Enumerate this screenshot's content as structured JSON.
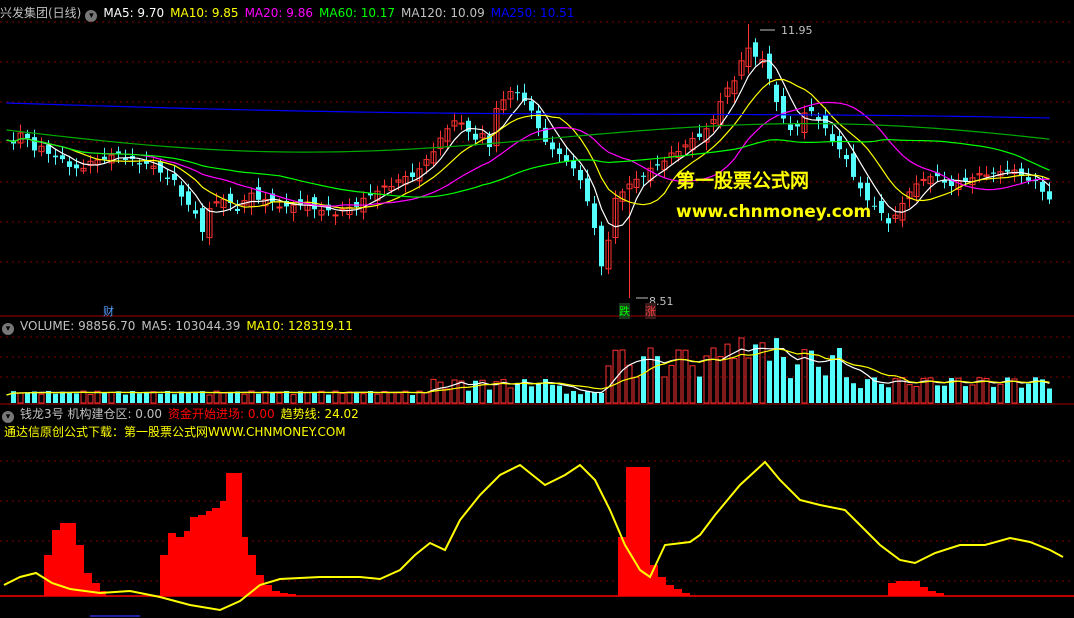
{
  "price_pane": {
    "stock": "兴发集团(日线)",
    "ma": [
      {
        "label": "MA5: 9.70",
        "color": "#ffffff"
      },
      {
        "label": "MA10: 9.85",
        "color": "#ffff00"
      },
      {
        "label": "MA20: 9.86",
        "color": "#ff00ff"
      },
      {
        "label": "MA60: 10.17",
        "color": "#00ff00"
      },
      {
        "label": "MA120: 10.09",
        "color": "#c0c0c0"
      },
      {
        "label": "MA250: 10.51",
        "color": "#0000ff"
      }
    ],
    "high_label": "11.95",
    "low_label": "8.51",
    "marker_cai": "财",
    "marker_die": "跌",
    "marker_zhang": "涨"
  },
  "volume_pane": {
    "labels": [
      {
        "label": "VOLUME: 98856.70",
        "color": "#c0c0c0"
      },
      {
        "label": "MA5: 103044.39",
        "color": "#c0c0c0"
      },
      {
        "label": "MA10: 128319.11",
        "color": "#ffff00"
      }
    ]
  },
  "indicator_pane": {
    "labels": [
      {
        "label": "钱龙3号  机构建仓区: 0.00",
        "color": "#c0c0c0"
      },
      {
        "label": "资金开始进场: 0.00",
        "color": "#ff0000"
      },
      {
        "label": "趋势线: 24.02",
        "color": "#ffff00"
      }
    ],
    "download_text": "通达信原创公式下载：第一股票公式网WWW.CHNMONEY.COM"
  },
  "watermark": {
    "line1": "第一股票公式网",
    "line2": "www.chnmoney.com"
  },
  "colors": {
    "up": "#ff3232",
    "down": "#54ffff",
    "grid": "#800000",
    "trend": "#ffff00",
    "bars": "#ff0000"
  }
}
